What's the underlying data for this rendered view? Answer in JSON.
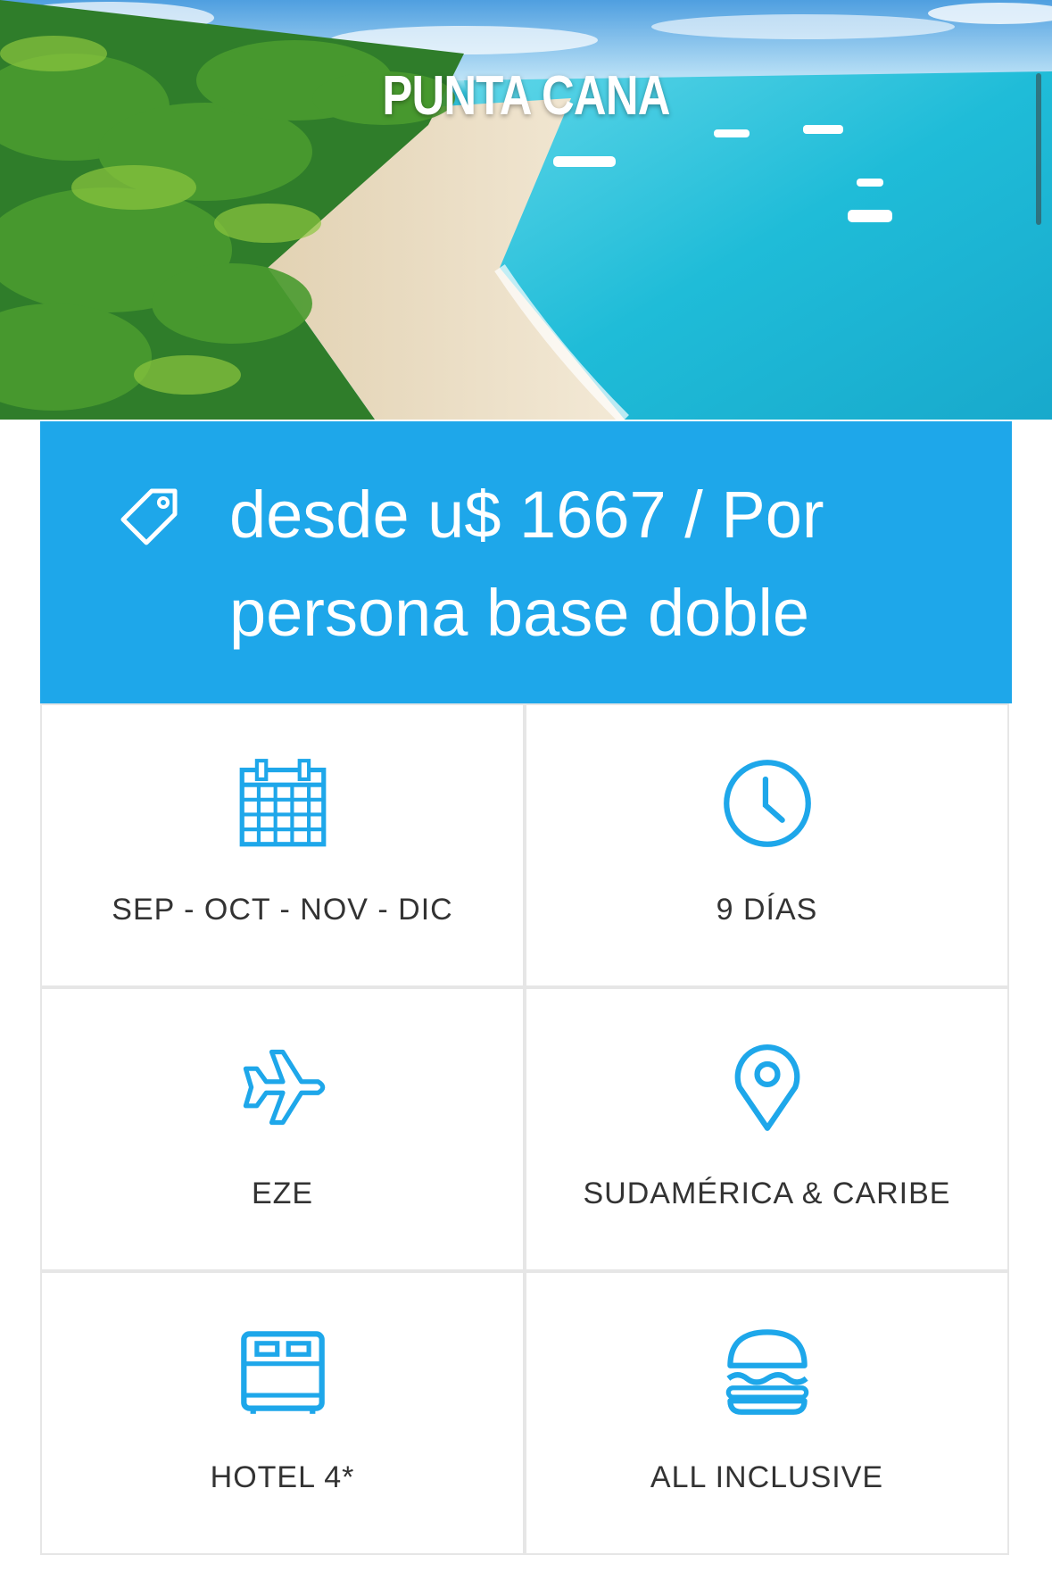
{
  "hero": {
    "title": "PUNTA CANA"
  },
  "price": {
    "text": "desde u$ 1667 / Por persona base doble",
    "icon": "tag-icon"
  },
  "features": [
    {
      "icon": "calendar-icon",
      "label": "SEP - OCT - NOV - DIC"
    },
    {
      "icon": "clock-icon",
      "label": "9 DÍAS"
    },
    {
      "icon": "plane-icon",
      "label": "EZE"
    },
    {
      "icon": "location-pin-icon",
      "label": "SUDAMÉRICA & CARIBE"
    },
    {
      "icon": "bed-icon",
      "label": "HOTEL 4*"
    },
    {
      "icon": "burger-icon",
      "label": "ALL INCLUSIVE"
    }
  ],
  "colors": {
    "accent": "#1ea7ea",
    "text": "#333333",
    "border": "#e6e6e6"
  }
}
